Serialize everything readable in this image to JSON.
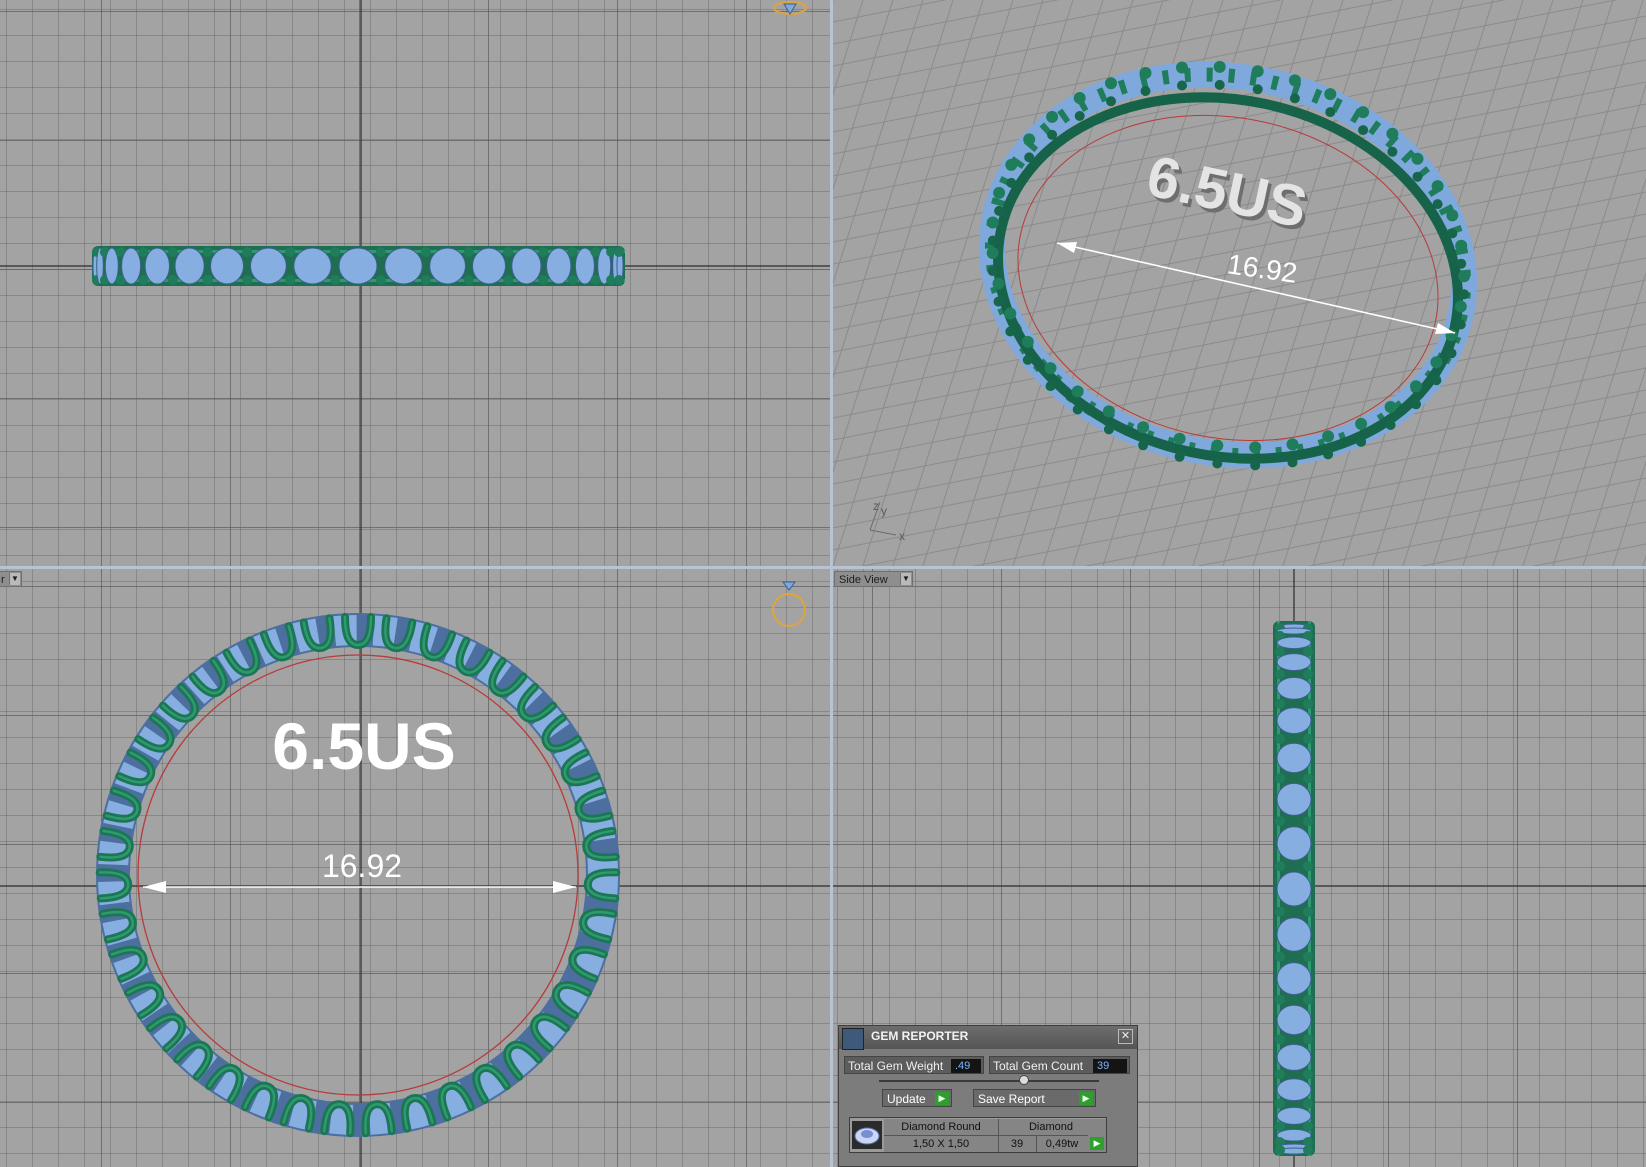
{
  "colors": {
    "viewport_bg": "#a3a3a3",
    "divider": "#b7c3d2",
    "metal": "#1f7d5c",
    "gem": "#7fa8dd",
    "dimension": "#ffffff",
    "inner_circle": "#b83a3a",
    "cam_icon": "#e0a53a"
  },
  "viewports": {
    "front_label": "r",
    "side_label": "Side View"
  },
  "annotations": {
    "front_size": "6.5US",
    "front_dimension": "16.92",
    "persp_size": "6.5US",
    "persp_dimension": "16.92"
  },
  "axes": {
    "z": "z",
    "y": "y",
    "x": "x"
  },
  "gem_reporter": {
    "title": "GEM REPORTER",
    "close_icon": "✕",
    "total_weight_label": "Total Gem Weight",
    "total_weight_value": ".49",
    "total_count_label": "Total Gem Count",
    "total_count_value": "39",
    "update_label": "Update",
    "save_report_label": "Save Report",
    "table": {
      "shape": "Diamond Round",
      "size": "1,50 X 1,50",
      "material": "Diamond",
      "count": "39",
      "weight": "0,49tw"
    }
  }
}
